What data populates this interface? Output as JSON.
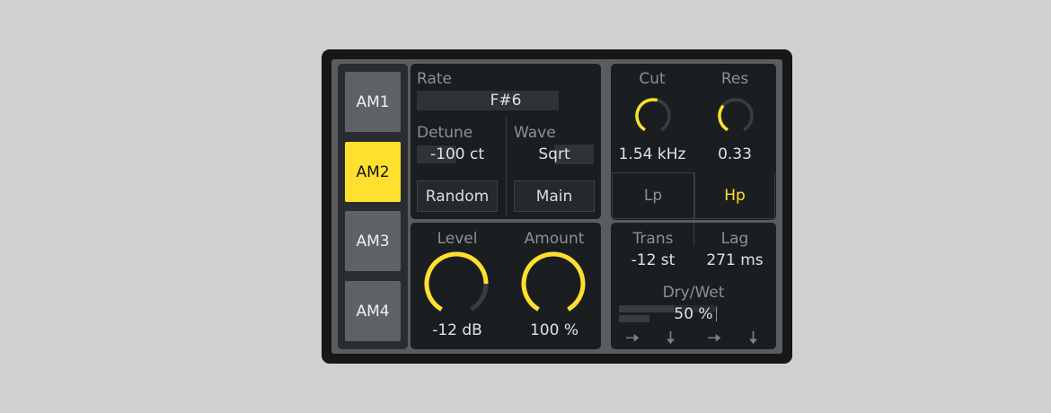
{
  "tabs": [
    "AM1",
    "AM2",
    "AM3",
    "AM4"
  ],
  "active_tab": "AM2",
  "rate": {
    "label": "Rate",
    "value": "F#6"
  },
  "detune": {
    "label": "Detune",
    "value": "-100 ct"
  },
  "wave": {
    "label": "Wave",
    "value": "Sqrt"
  },
  "buttons": {
    "random": "Random",
    "main": "Main"
  },
  "level": {
    "label": "Level",
    "value": "-12 dB",
    "knob_fraction": 0.8
  },
  "amount": {
    "label": "Amount",
    "value": "100 %",
    "knob_fraction": 1.0
  },
  "cut": {
    "label": "Cut",
    "value": "1.54 kHz",
    "knob_fraction": 0.55
  },
  "res": {
    "label": "Res",
    "value": "0.33",
    "knob_fraction": 0.33
  },
  "filter_type": {
    "lp": "Lp",
    "hp": "Hp",
    "selected": "Hp"
  },
  "trans": {
    "label": "Trans",
    "value": "-12 st"
  },
  "lag": {
    "label": "Lag",
    "value": "271 ms"
  },
  "drywet": {
    "label": "Dry/Wet",
    "value": "50 %",
    "fraction": 0.5
  },
  "routing_icons": [
    "arrow-right-icon",
    "arrow-down-icon",
    "arrow-right-icon",
    "arrow-down-icon"
  ],
  "colors": {
    "accent": "#ffe02e",
    "panel": "#1b1e21",
    "device_bg": "#151719",
    "track": "#3a3d40"
  }
}
